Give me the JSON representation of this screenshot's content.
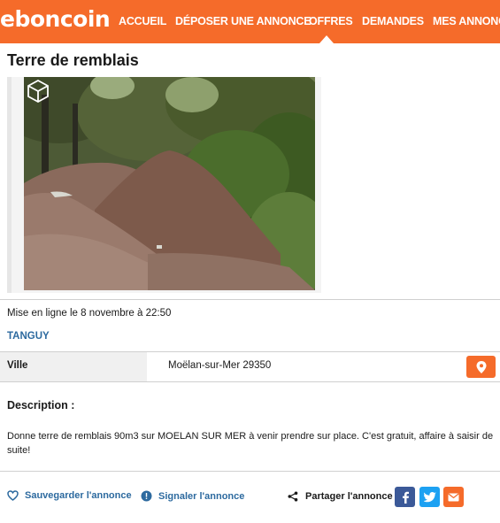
{
  "header": {
    "logo": "eboncoin",
    "nav": [
      {
        "label": "ACCUEIL"
      },
      {
        "label": "DÉPOSER UNE ANNONCE"
      },
      {
        "label": "OFFRES"
      },
      {
        "label": "DEMANDES"
      },
      {
        "label": "MES ANNONCES"
      }
    ],
    "active_nav": "OFFRES",
    "brand_color": "#f56b2a"
  },
  "ad": {
    "title": "Terre de remblais",
    "image_badge_icon": "cube-3d-icon",
    "published": "Mise en ligne le 8 novembre à 22:50",
    "author": "TANGUY",
    "location_label": "Ville",
    "location_value": "Moëlan-sur-Mer 29350",
    "description_heading": "Description :",
    "description": "Donne terre de remblais 90m3 sur MOELAN SUR MER à venir prendre sur place. C'est gratuit, affaire à saisir de suite!"
  },
  "actions": {
    "save": "Sauvegarder l'annonce",
    "report": "Signaler l'annonce",
    "share": "Partager l'annonce",
    "social": [
      {
        "icon": "facebook-icon",
        "color": "#3b5998"
      },
      {
        "icon": "twitter-icon",
        "color": "#1da1f2"
      },
      {
        "icon": "mail-icon",
        "color": "#f56b2a"
      }
    ]
  },
  "colors": {
    "link_blue": "#2d6a9f",
    "save_icon": "#2d6a9f"
  }
}
